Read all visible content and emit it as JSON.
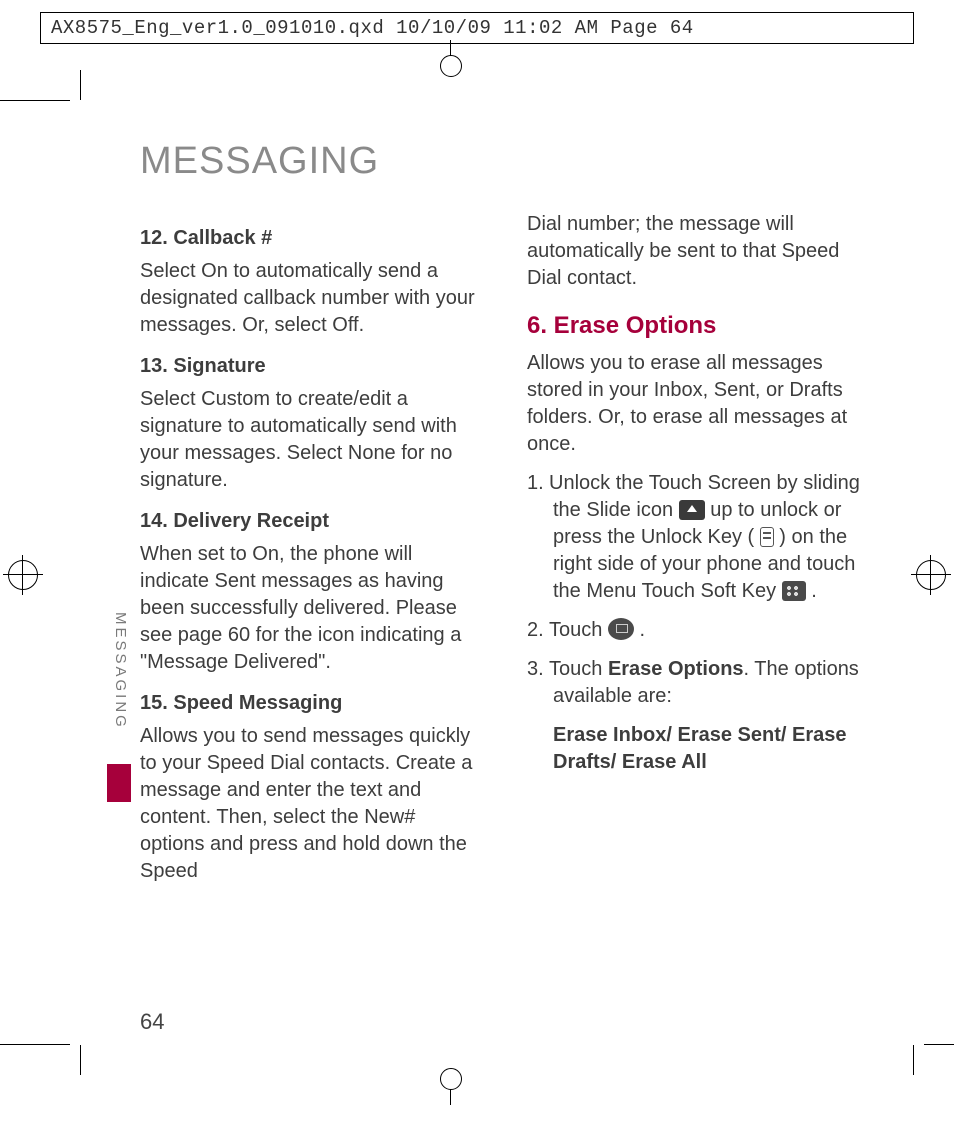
{
  "printer_header": "AX8575_Eng_ver1.0_091010.qxd  10/10/09  11:02 AM  Page 64",
  "sidebar_tab": "MESSAGING",
  "page_number": "64",
  "title": "MESSAGING",
  "left": {
    "h12": "12. Callback #",
    "p12": "Select On to automatically send a designated callback number with your messages. Or, select Off.",
    "h13": "13. Signature",
    "p13": "Select Custom to create/edit a signature to automatically send with your messages. Select None for no signature.",
    "h14": "14. Delivery Receipt",
    "p14": "When set to On, the phone will indicate Sent messages as having been successfully delivered. Please see page 60 for the icon indicating a \"Message Delivered\".",
    "h15": "15. Speed Messaging",
    "p15": "Allows you to send messages quickly to your Speed Dial contacts. Create a message and enter the text and content. Then, select the New# options and press and hold down the Speed"
  },
  "right": {
    "cont": "Dial number; the message will automatically be sent to that Speed Dial contact.",
    "h6": "6. Erase Options",
    "intro": "Allows you to erase all messages stored in your Inbox, Sent, or Drafts folders. Or, to erase all messages at once.",
    "s1a": "Unlock the Touch Screen by sliding the Slide icon ",
    "s1b": " up to unlock or press the Unlock Key ( ",
    "s1c": " ) on the right side of your phone and touch the Menu Touch Soft Key ",
    "s1d": " .",
    "s2a": "Touch ",
    "s2b": " .",
    "s3a": "Touch ",
    "s3b": "Erase Options",
    "s3c": ". The options available are:",
    "opts": "Erase Inbox/ Erase Sent/ Erase Drafts/ Erase All",
    "n1": "1.",
    "n2": "2.",
    "n3": "3."
  }
}
